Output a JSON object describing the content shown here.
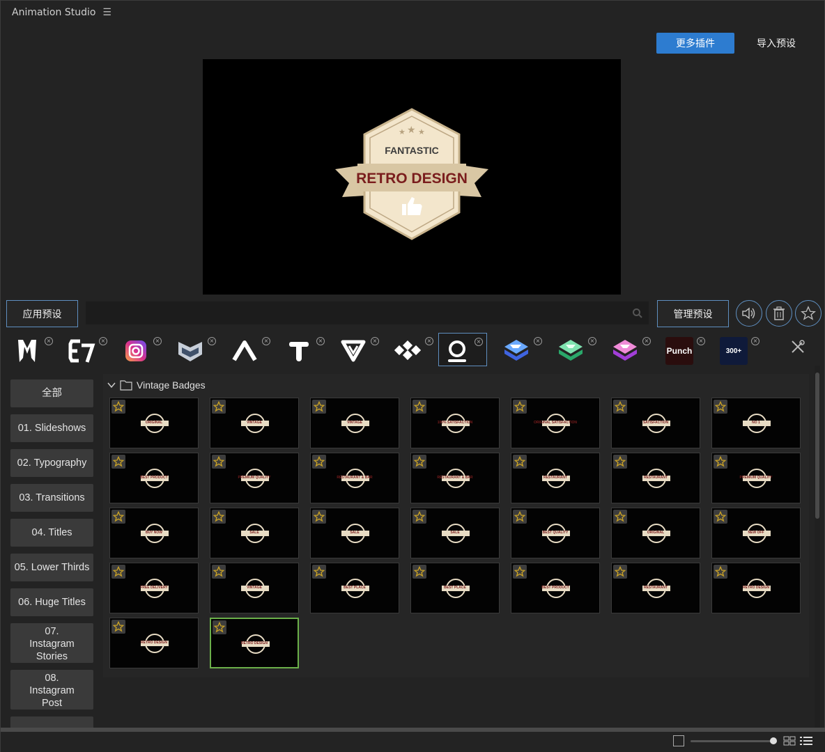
{
  "app": {
    "title": "Animation Studio",
    "menu_icon": "hamburger-menu-icon"
  },
  "header": {
    "more_plugins_label": "更多插件",
    "import_preset_label": "导入预设",
    "accent_color": "#2d7cd0"
  },
  "preview": {
    "badge_top_text": "FANTASTIC",
    "badge_ribbon_text": "RETRO DESIGN",
    "badge_icon": "thumbs-up-icon",
    "colors": {
      "badge_fill": "#efe1c6",
      "ribbon_fill": "#d8c6a3",
      "ribbon_text": "#7a1d1d",
      "hex_fill": "#f3e6cc"
    }
  },
  "toolbar": {
    "apply_label": "应用预设",
    "search_placeholder": "",
    "manage_label": "管理预设",
    "sound_icon": "speaker-icon",
    "delete_icon": "trash-icon",
    "favorite_icon": "star-icon"
  },
  "plugins": [
    {
      "icon": "m-logo-icon"
    },
    {
      "icon": "e7-logo-icon"
    },
    {
      "icon": "instagram-logo-icon"
    },
    {
      "icon": "chevron-badge-icon"
    },
    {
      "icon": "a-logo-icon"
    },
    {
      "icon": "t-logo-icon"
    },
    {
      "icon": "v-logo-icon"
    },
    {
      "icon": "nodes-logo-icon"
    },
    {
      "icon": "q-logo-icon",
      "selected": true
    },
    {
      "icon": "blue-layers-icon"
    },
    {
      "icon": "green-layers-icon"
    },
    {
      "icon": "pink-layers-icon"
    },
    {
      "icon": "punch-logo-icon",
      "label": "Punch"
    },
    {
      "icon": "transitions-pack-icon",
      "label": "300+"
    }
  ],
  "sidebar": {
    "items": [
      {
        "label": "全部",
        "lines": 1
      },
      {
        "label": "01. Slideshows",
        "lines": 1
      },
      {
        "label": "02. Typography",
        "lines": 1
      },
      {
        "label": "03. Transitions",
        "lines": 1
      },
      {
        "label": "04. Titles",
        "lines": 1
      },
      {
        "label": "05. Lower Thirds",
        "lines": 1
      },
      {
        "label": "06. Huge Titles",
        "lines": 1
      },
      {
        "label": "07. Instagram Stories",
        "lines": 2
      },
      {
        "label": "08. Instagram Post",
        "lines": 2
      }
    ]
  },
  "library": {
    "folder_name": "Vintage Badges",
    "folder_expanded": true,
    "thumbnails": [
      {
        "label": "ORIGINAL"
      },
      {
        "label": "VINTAGE"
      },
      {
        "label": "VINTAGE"
      },
      {
        "label": "100% SATISFACTION"
      },
      {
        "label": "ORIGINAL SATISFACTION"
      },
      {
        "label": "SATISFACTION"
      },
      {
        "label": "NO 1"
      },
      {
        "label": "BEST PRODUCT"
      },
      {
        "label": "PREMIUM QUALITY"
      },
      {
        "label": "RESTAURANT & BAR"
      },
      {
        "label": "RESTAURANT & BAR"
      },
      {
        "label": "RESTAURANT"
      },
      {
        "label": "RESTAURANT"
      },
      {
        "label": "PREMIUM QUALITY"
      },
      {
        "label": "BUY NOW"
      },
      {
        "label": "SALE"
      },
      {
        "label": "SALE"
      },
      {
        "label": "SALE"
      },
      {
        "label": "BEST QUALITY"
      },
      {
        "label": "ORIGINAL"
      },
      {
        "label": "NEW OFF"
      },
      {
        "label": "FREE DELIVERY"
      },
      {
        "label": "VINTAGE"
      },
      {
        "label": "BEST PLACE"
      },
      {
        "label": "BEST PLACE"
      },
      {
        "label": "BEST PRODUCT"
      },
      {
        "label": "RESTAURANT"
      },
      {
        "label": "RETRO DESIGN"
      },
      {
        "label": "RETRO DESIGN"
      },
      {
        "label": "RETRO DESIGN",
        "selected": true
      }
    ],
    "star_color": "#c9a227"
  },
  "statusbar": {
    "zoom_icon": "fit-view-icon",
    "grid_view_icon": "grid-view-icon",
    "list_view_icon": "list-view-icon"
  }
}
